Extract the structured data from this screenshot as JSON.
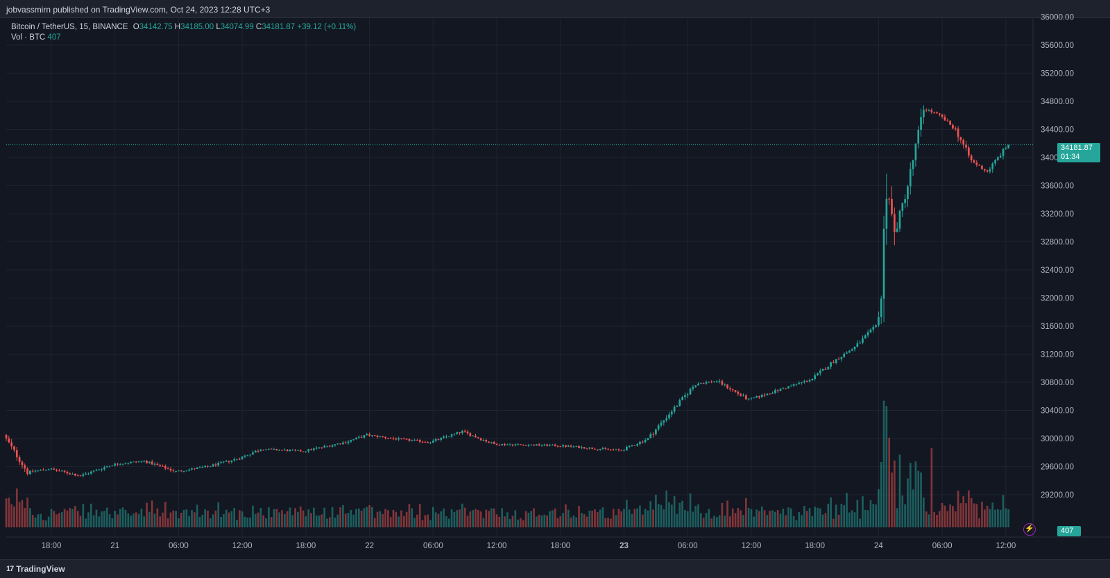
{
  "header": {
    "published": "jobvassmirn published on TradingView.com, Oct 24, 2023 12:28 UTC+3"
  },
  "legend": {
    "symbol": "Bitcoin / TetherUS, 15, BINANCE",
    "open_label": "O",
    "open": "34142.75",
    "high_label": "H",
    "high": "34185.00",
    "low_label": "L",
    "low": "34074.99",
    "close_label": "C",
    "close": "34181.87",
    "change": "+39.12 (+0.11%)",
    "vol_label": "Vol · BTC",
    "vol": "407"
  },
  "price_tag": {
    "price": "34181.87",
    "countdown": "01:34"
  },
  "vol_tag": "407",
  "footer": {
    "brand": "TradingView",
    "logo_text": "17"
  },
  "colors": {
    "up": "#26a69a",
    "down": "#ef5350",
    "background": "#131722",
    "grid": "#1f2330",
    "accent": "#9c27b0"
  },
  "icons": {
    "flash": "lightning-icon"
  },
  "chart_data": {
    "type": "candlestick",
    "title": "Bitcoin / TetherUS, 15, BINANCE",
    "interval": "15",
    "y_axis": {
      "ticks": [
        29200,
        29600,
        30000,
        30400,
        30800,
        31200,
        31600,
        32000,
        32400,
        32800,
        33200,
        33600,
        34000,
        34400,
        34800,
        35200,
        35600,
        36000
      ],
      "tick_labels": [
        "29200.00",
        "29600.00",
        "30000.00",
        "30400.00",
        "30800.00",
        "31200.00",
        "31600.00",
        "32000.00",
        "32400.00",
        "32800.00",
        "33200.00",
        "33600.00",
        "34000.00",
        "34400.00",
        "34800.00",
        "35200.00",
        "35600.00",
        "36000.00"
      ],
      "ylim": [
        28800,
        36100
      ]
    },
    "x_axis": {
      "tick_labels": [
        "18:00",
        "21",
        "06:00",
        "12:00",
        "18:00",
        "22",
        "06:00",
        "12:00",
        "18:00",
        "23",
        "06:00",
        "12:00",
        "18:00",
        "24",
        "06:00",
        "12:00"
      ],
      "bold_ticks": [
        "23"
      ],
      "start": "2023-10-20 13:45",
      "end": "2023-10-24 12:28"
    },
    "last_price": 34181.87,
    "price_path": [
      {
        "t": "2023-10-20 13:45",
        "p": 30050
      },
      {
        "t": "2023-10-20 16:00",
        "p": 29520
      },
      {
        "t": "2023-10-20 18:00",
        "p": 29570
      },
      {
        "t": "2023-10-20 21:00",
        "p": 29470
      },
      {
        "t": "2023-10-21 00:00",
        "p": 29630
      },
      {
        "t": "2023-10-21 03:00",
        "p": 29680
      },
      {
        "t": "2023-10-21 06:00",
        "p": 29530
      },
      {
        "t": "2023-10-21 09:00",
        "p": 29600
      },
      {
        "t": "2023-10-21 12:00",
        "p": 29720
      },
      {
        "t": "2023-10-21 14:00",
        "p": 29850
      },
      {
        "t": "2023-10-21 18:00",
        "p": 29820
      },
      {
        "t": "2023-10-21 22:00",
        "p": 29950
      },
      {
        "t": "2023-10-22 00:00",
        "p": 30050
      },
      {
        "t": "2023-10-22 03:00",
        "p": 29990
      },
      {
        "t": "2023-10-22 06:00",
        "p": 29950
      },
      {
        "t": "2023-10-22 09:00",
        "p": 30100
      },
      {
        "t": "2023-10-22 12:00",
        "p": 29920
      },
      {
        "t": "2023-10-22 18:00",
        "p": 29900
      },
      {
        "t": "2023-10-23 00:00",
        "p": 29830
      },
      {
        "t": "2023-10-23 02:30",
        "p": 30000
      },
      {
        "t": "2023-10-23 04:30",
        "p": 30350
      },
      {
        "t": "2023-10-23 07:00",
        "p": 30780
      },
      {
        "t": "2023-10-23 09:00",
        "p": 30820
      },
      {
        "t": "2023-10-23 12:00",
        "p": 30550
      },
      {
        "t": "2023-10-23 15:00",
        "p": 30700
      },
      {
        "t": "2023-10-23 18:00",
        "p": 30850
      },
      {
        "t": "2023-10-23 20:00",
        "p": 31100
      },
      {
        "t": "2023-10-23 22:00",
        "p": 31300
      },
      {
        "t": "2023-10-24 00:00",
        "p": 31600
      },
      {
        "t": "2023-10-24 00:30",
        "p": 32000
      },
      {
        "t": "2023-10-24 01:00",
        "p": 33700
      },
      {
        "t": "2023-10-24 01:45",
        "p": 32900
      },
      {
        "t": "2023-10-24 03:00",
        "p": 33600
      },
      {
        "t": "2023-10-24 04:30",
        "p": 34700
      },
      {
        "t": "2023-10-24 06:00",
        "p": 34600
      },
      {
        "t": "2023-10-24 07:30",
        "p": 34400
      },
      {
        "t": "2023-10-24 09:00",
        "p": 33950
      },
      {
        "t": "2023-10-24 10:30",
        "p": 33800
      },
      {
        "t": "2023-10-24 12:28",
        "p": 34181.87
      }
    ],
    "volume_bursts": [
      {
        "t": "2023-10-24 00:45",
        "v": 4.6
      },
      {
        "t": "2023-10-24 01:00",
        "v": 3.4
      },
      {
        "t": "2023-10-24 05:00",
        "v": 3.0
      },
      {
        "t": "2023-10-23 04:00",
        "v": 1.4
      },
      {
        "t": "2023-10-23 21:00",
        "v": 1.3
      }
    ]
  }
}
